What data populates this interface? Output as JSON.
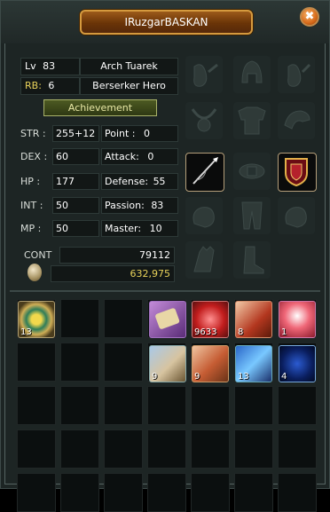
{
  "window": {
    "title": "IRuzgarBASKAN",
    "close_glyph": "✖"
  },
  "character": {
    "level_label": "Lv",
    "level": "83",
    "name": "Arch Tuarek",
    "rb_label": "RB:",
    "rb": "6",
    "class": "Berserker Hero",
    "achievement_label": "Achievement"
  },
  "stats": {
    "str_label": "STR :",
    "str": "255+12",
    "dex_label": "DEX :",
    "dex": "60",
    "hp_label": "HP :",
    "hp": "177",
    "int_label": "INT :",
    "int": "50",
    "mp_label": "MP :",
    "mp": "50",
    "point_label": "Point :",
    "point": "0",
    "attack_label": "Attack:",
    "attack": "0",
    "defense_label": "Defense:",
    "defense": "55",
    "passion_label": "Passion:",
    "passion": "83",
    "master_label": "Master:",
    "master": "10"
  },
  "currency": {
    "cont_label": "CONT",
    "cont": "79112",
    "coins": "632,975"
  },
  "inventory": {
    "item_13": "13",
    "item_9633": "9633",
    "item_8": "8",
    "item_1": "1",
    "item_9a": "9",
    "item_9b": "9",
    "item_13b": "13",
    "item_4": "4"
  }
}
